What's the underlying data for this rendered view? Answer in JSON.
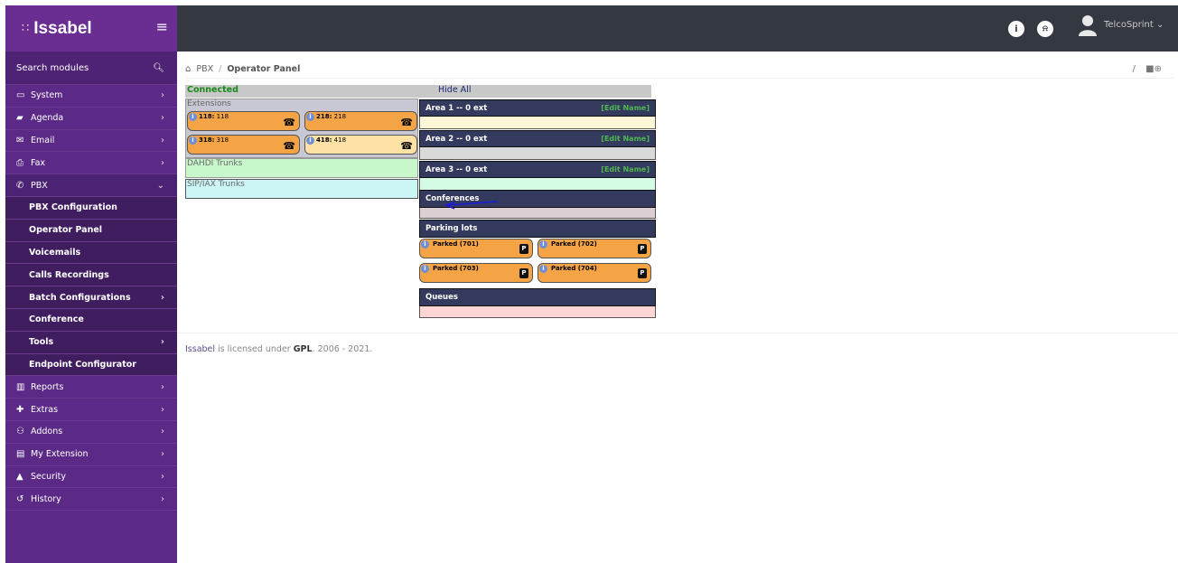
{
  "brand": {
    "name": "Issabel",
    "dots": "∷"
  },
  "sidebar": {
    "search_label": "Search modules",
    "items": [
      {
        "label": "System",
        "icon": "laptop-icon",
        "chev": "›",
        "kind": "top"
      },
      {
        "label": "Agenda",
        "icon": "book-icon",
        "chev": "›",
        "kind": "top"
      },
      {
        "label": "Email",
        "icon": "envelope-icon",
        "chev": "›",
        "kind": "top"
      },
      {
        "label": "Fax",
        "icon": "printer-icon",
        "chev": "›",
        "kind": "top"
      },
      {
        "label": "PBX",
        "icon": "phone-icon",
        "chev": "⌄",
        "kind": "top-open"
      },
      {
        "label": "PBX Configuration",
        "kind": "sub"
      },
      {
        "label": "Operator Panel",
        "kind": "sub"
      },
      {
        "label": "Voicemails",
        "kind": "sub"
      },
      {
        "label": "Calls Recordings",
        "kind": "sub"
      },
      {
        "label": "Batch Configurations",
        "chev": "›",
        "kind": "sub"
      },
      {
        "label": "Conference",
        "kind": "sub"
      },
      {
        "label": "Tools",
        "chev": "›",
        "kind": "sub"
      },
      {
        "label": "Endpoint Configurator",
        "kind": "sub"
      },
      {
        "label": "Reports",
        "icon": "chart-icon",
        "chev": "›",
        "kind": "top"
      },
      {
        "label": "Extras",
        "icon": "plus-icon",
        "chev": "›",
        "kind": "top"
      },
      {
        "label": "Addons",
        "icon": "users-icon",
        "chev": "›",
        "kind": "top"
      },
      {
        "label": "My Extension",
        "icon": "briefcase-icon",
        "chev": "›",
        "kind": "top"
      },
      {
        "label": "Security",
        "icon": "lock-icon",
        "chev": "›",
        "kind": "top"
      },
      {
        "label": "History",
        "icon": "history-icon",
        "chev": "›",
        "kind": "top"
      }
    ]
  },
  "topbar": {
    "user": "TelcoSprint ⌄",
    "info_glyph": "i",
    "bell_glyph": "🔔"
  },
  "breadcrumb": {
    "root": "PBX",
    "sep": "/",
    "current": "Operator Panel",
    "right_sep": "/",
    "right_icons": "■⊕"
  },
  "panel": {
    "status": "Connected",
    "hide_all": "Hide All",
    "extensions_title": "Extensions",
    "extensions": [
      {
        "num": "118:",
        "name": "118",
        "style": "orange"
      },
      {
        "num": "218:",
        "name": "218",
        "style": "orange"
      },
      {
        "num": "318:",
        "name": "318",
        "style": "orange"
      },
      {
        "num": "418:",
        "name": "418",
        "style": "lightorange"
      }
    ],
    "dahdi_title": "DAHDI Trunks",
    "sipiax_title": "SIP/IAX Trunks",
    "areas": [
      {
        "label": "Area 1 -- 0 ext",
        "edit": "[Edit Name]",
        "body_color": "#fef7d7"
      },
      {
        "label": "Area 2 -- 0 ext",
        "edit": "[Edit Name]",
        "body_color": "#d9d9d9"
      },
      {
        "label": "Area 3 -- 0 ext",
        "edit": "[Edit Name]",
        "body_color": "#d4fbe4"
      }
    ],
    "conferences_title": "Conferences",
    "parking_title": "Parking lots",
    "parked": [
      "Parked (701)",
      "Parked (702)",
      "Parked (703)",
      "Parked (704)"
    ],
    "queues_title": "Queues"
  },
  "footer": {
    "brand": "Issabel",
    "text1": " is licensed under ",
    "gpl": "GPL",
    "text2": ". 2006 - 2021."
  }
}
